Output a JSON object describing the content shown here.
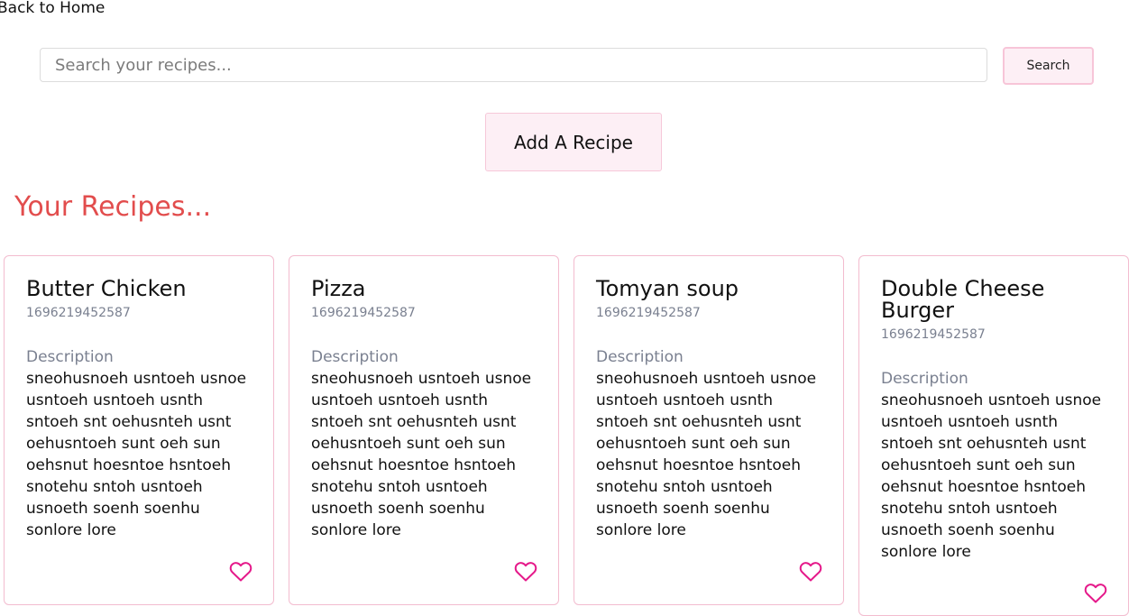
{
  "nav": {
    "back_label": "Back to Home"
  },
  "search": {
    "placeholder": "Search your recipes...",
    "button_label": "Search"
  },
  "add_button_label": "Add A Recipe",
  "section_title": "Your Recipes...",
  "colors": {
    "accent_pink": "#e5198a",
    "title_red": "#e24d4d",
    "button_bg": "#fdeff5",
    "card_border": "#f3bccf"
  },
  "cards": [
    {
      "title": "Butter Chicken",
      "id": "1696219452587",
      "description_label": "Description",
      "description": "sneohusnoeh usntoeh usnoe usntoeh usntoeh usnth sntoeh snt oehusnteh usnt oehusntoeh sunt oeh sun oehsnut hoesntoe hsntoeh snotehu sntoh usntoeh usnoeth soenh soenhu sonlore lore",
      "icon": "heart-outline-icon"
    },
    {
      "title": "Pizza",
      "id": "1696219452587",
      "description_label": "Description",
      "description": "sneohusnoeh usntoeh usnoe usntoeh usntoeh usnth sntoeh snt oehusnteh usnt oehusntoeh sunt oeh sun oehsnut hoesntoe hsntoeh snotehu sntoh usntoeh usnoeth soenh soenhu sonlore lore",
      "icon": "heart-outline-icon"
    },
    {
      "title": "Tomyan soup",
      "id": "1696219452587",
      "description_label": "Description",
      "description": "sneohusnoeh usntoeh usnoe usntoeh usntoeh usnth sntoeh snt oehusnteh usnt oehusntoeh sunt oeh sun oehsnut hoesntoe hsntoeh snotehu sntoh usntoeh usnoeth soenh soenhu sonlore lore",
      "icon": "heart-outline-icon"
    },
    {
      "title": "Double Cheese Burger",
      "id": "1696219452587",
      "description_label": "Description",
      "description": "sneohusnoeh usntoeh usnoe usntoeh usntoeh usnth sntoeh snt oehusnteh usnt oehusntoeh sunt oeh sun oehsnut hoesntoe hsntoeh snotehu sntoh usntoeh usnoeth soenh soenhu sonlore lore",
      "icon": "heart-outline-icon"
    }
  ]
}
